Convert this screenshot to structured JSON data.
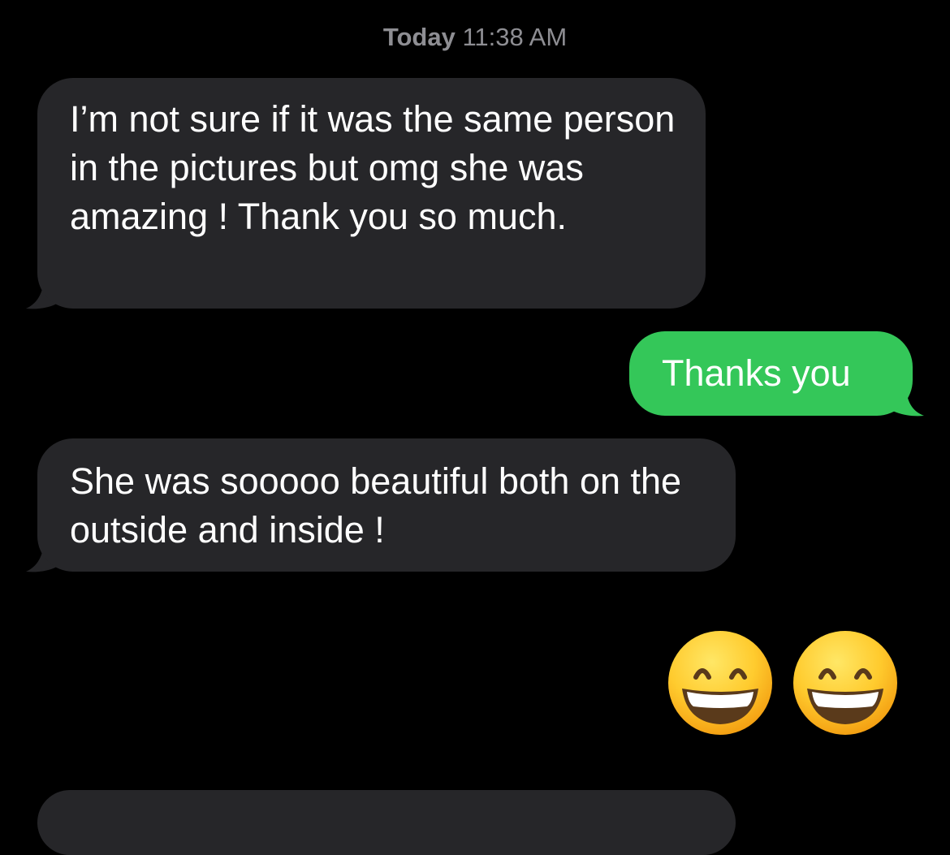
{
  "conversation": {
    "timestamp_day": "Today",
    "timestamp_time": "11:38 AM",
    "messages": [
      {
        "from": "received",
        "text": "I’m not sure if it was the same person in the pictures but omg she was amazing ! Thank you so much."
      },
      {
        "from": "sent",
        "text": "Thanks you"
      },
      {
        "from": "received",
        "text": "She was sooooo beautiful both on the outside and inside !"
      },
      {
        "from": "sent",
        "emoji": [
          "grinning-face-with-smiling-eyes-icon",
          "grinning-face-with-smiling-eyes-icon"
        ]
      },
      {
        "from": "received",
        "text": ""
      }
    ]
  },
  "colors": {
    "background": "#000000",
    "received_bubble": "#262629",
    "sent_bubble": "#34c759",
    "timestamp": "#8e8e93"
  }
}
